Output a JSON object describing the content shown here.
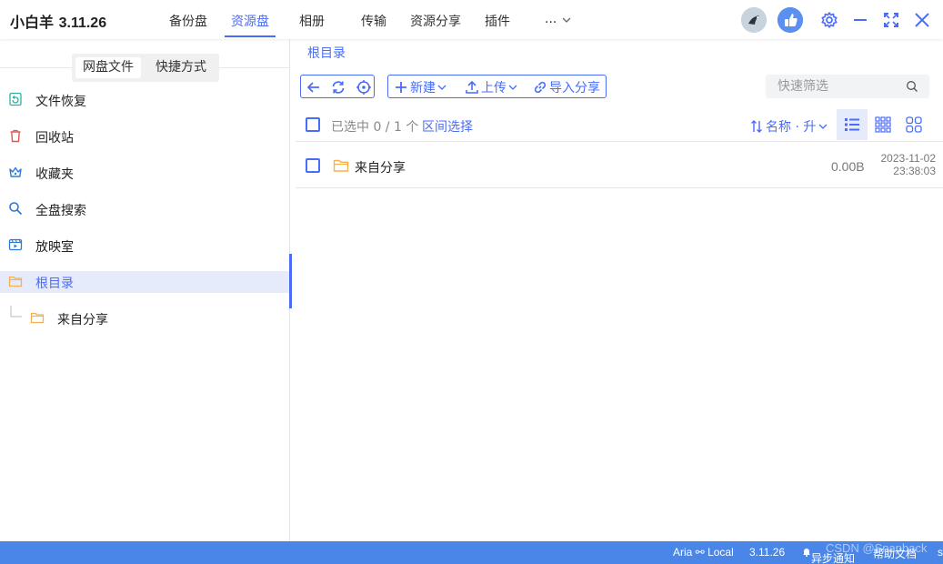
{
  "app": {
    "name": "小白羊",
    "version": "3.11.26"
  },
  "nav": {
    "tabs": [
      {
        "label": "备份盘"
      },
      {
        "label": "资源盘"
      },
      {
        "label": "相册"
      },
      {
        "label": "传输"
      },
      {
        "label": "资源分享"
      },
      {
        "label": "插件"
      },
      {
        "label": "..."
      }
    ],
    "active": "资源盘"
  },
  "sidebar": {
    "segments": [
      {
        "label": "网盘文件"
      },
      {
        "label": "快捷方式"
      }
    ],
    "items": [
      {
        "label": "文件恢复",
        "icon": "file-restore-icon"
      },
      {
        "label": "回收站",
        "icon": "trash-icon"
      },
      {
        "label": "收藏夹",
        "icon": "crown-icon"
      },
      {
        "label": "全盘搜索",
        "icon": "search-icon"
      },
      {
        "label": "放映室",
        "icon": "video-icon"
      },
      {
        "label": "根目录",
        "icon": "folder-icon"
      }
    ],
    "tree_child": {
      "label": "来自分享"
    }
  },
  "main": {
    "breadcrumb": "根目录",
    "toolbar": {
      "new_label": "新建",
      "upload_label": "上传",
      "import_label": "导入分享"
    },
    "search": {
      "placeholder": "快速筛选"
    },
    "header": {
      "selection": "已选中 0 / 1 个",
      "range_select": "区间选择",
      "sort": "名称 · 升"
    },
    "files": [
      {
        "name": "来自分享",
        "size": "0.00B",
        "date": "2023-11-02",
        "time": "23:38:03"
      }
    ]
  },
  "status": {
    "aria": "Aria ⚯ Local",
    "version": "3.11.26",
    "notify": "异步通知",
    "help": "帮助文档",
    "extra": "s",
    "watermark": "CSDN @Snapback"
  },
  "colors": {
    "accent": "#4a6cf7",
    "statusbar": "#4a86e8",
    "folder": "#f5b14c"
  }
}
